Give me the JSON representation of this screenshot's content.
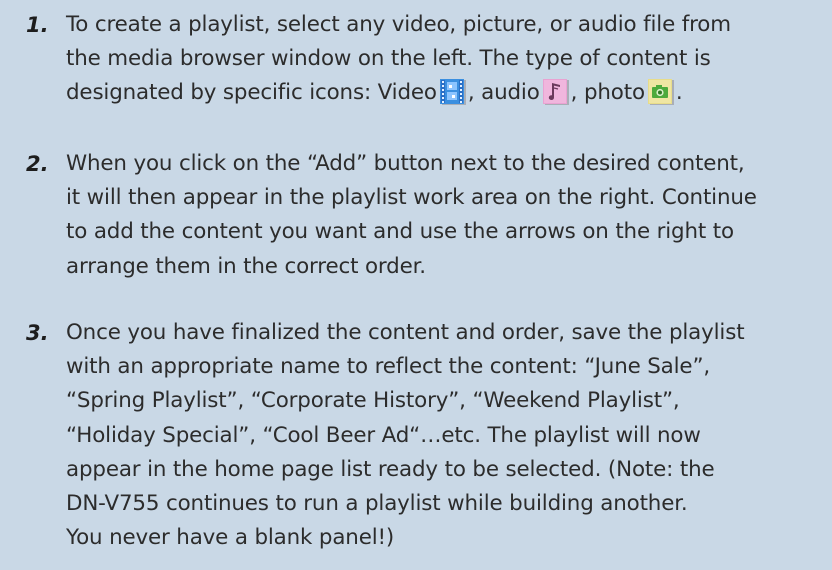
{
  "steps": [
    {
      "number": "1.",
      "lines": [
        "To create a playlist, select any video, picture, or audio file from",
        "the media browser window on the left. The type of content is"
      ],
      "icons_line": {
        "prefix": "designated by specific icons: Video",
        "sep_audio": ", audio",
        "sep_photo": ", photo",
        "suffix": "."
      },
      "icons": [
        "video-icon",
        "audio-icon",
        "photo-icon"
      ]
    },
    {
      "number": "2.",
      "lines": [
        "When you click on the “Add” button next to the desired content,",
        "it will then appear in the playlist work area on the right. Continue",
        "to add the content you want and use the arrows on the right to",
        "arrange them in the correct order."
      ]
    },
    {
      "number": "3.",
      "lines": [
        "Once you have finalized the content and order, save the playlist",
        "with an appropriate name to reflect the content: “June Sale”,",
        "“Spring Playlist”, “Corporate History”, “Weekend Playlist”,",
        "“Holiday Special”, “Cool Beer Ad“…etc. The playlist will now",
        "appear in the home page list ready to be selected. (Note: the",
        "DN-V755 continues to run a playlist while building another.",
        "You never have a blank panel!)"
      ]
    }
  ],
  "colors": {
    "background": "#c9d8e6",
    "text": "#2c2c2c",
    "video_icon": "#3a8fe0",
    "audio_icon": "#e9a2d2",
    "photo_icon": "#e8dd8a"
  }
}
